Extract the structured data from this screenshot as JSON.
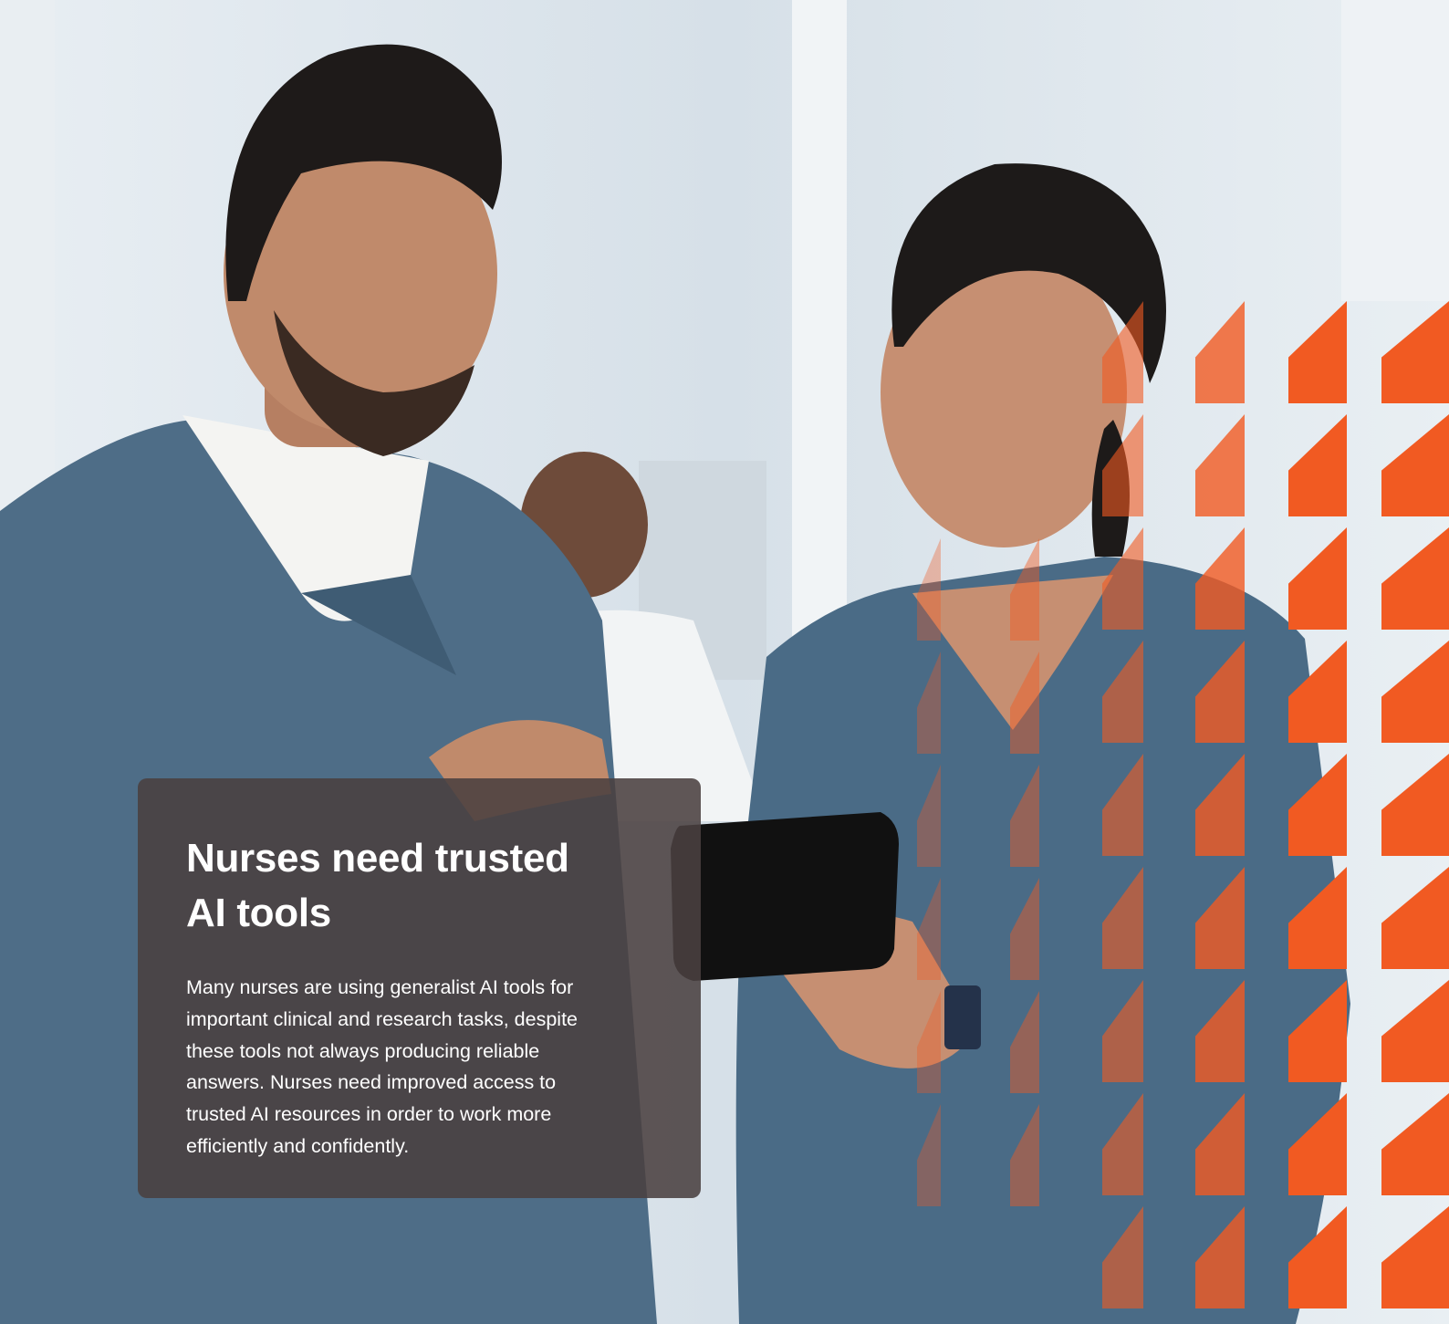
{
  "card": {
    "title": "Nurses need trusted\nAI tools",
    "body": "Many nurses are using generalist AI tools for\nimportant clinical and research tasks, despite\nthese tools not always producing reliable\nanswers. Nurses need improved access to\ntrusted AI resources in order to work more\nefficiently and confidently."
  },
  "photo": {
    "subject": "Two nurses in blue scrubs reviewing a tablet in a hospital corridor, a doctor in a white coat in the background"
  },
  "pattern": {
    "accent_color": "#f15a22"
  },
  "colors": {
    "background": "#dfe7ee",
    "scrubs": "#4a6b86",
    "card": "#4a4040"
  }
}
